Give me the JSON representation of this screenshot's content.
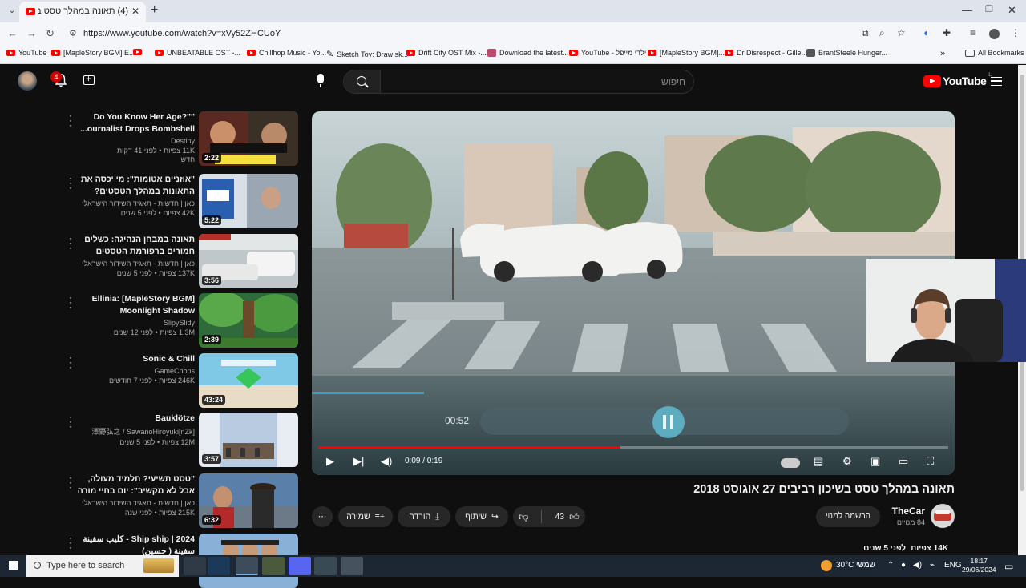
{
  "browser": {
    "tab_title": "(4) תאונה במהלך טסט בשיכון ר",
    "url": "https://www.youtube.com/watch?v=xVy52ZHCUoY",
    "bookmarks": [
      {
        "label": "YouTube",
        "icon": "youtube-icon"
      },
      {
        "label": "[MapleStory BGM] E...",
        "icon": "youtube-icon"
      },
      {
        "label": "",
        "icon": "youtube-icon"
      },
      {
        "label": "UNBEATABLE OST -...",
        "icon": "youtube-icon"
      },
      {
        "label": "Chillhop Music - Yo...",
        "icon": "youtube-icon"
      },
      {
        "label": "Sketch Toy: Draw sk...",
        "icon": "pencil-icon"
      },
      {
        "label": "Drift City OST Mix -...",
        "icon": "youtube-icon"
      },
      {
        "label": "Download the latest...",
        "icon": "image-icon"
      },
      {
        "label": "YouTube - ילדי מייפל",
        "icon": "youtube-icon"
      },
      {
        "label": "[MapleStory BGM]...",
        "icon": "youtube-icon"
      },
      {
        "label": "Dr Disrespect - Gille...",
        "icon": "youtube-icon"
      },
      {
        "label": "BrantSteele Hunger...",
        "icon": "site-icon"
      }
    ],
    "all_bookmarks": "All Bookmarks"
  },
  "header": {
    "notification_count": "4",
    "search_placeholder": "חיפוש",
    "logo_text": "YouTube",
    "logo_country": "IL"
  },
  "related": [
    {
      "title": "Do You Know Her Age?\"\" ...ournalist Drops Bombshell On",
      "channel": "Destiny",
      "meta": "11K צפיות • לפני 41 דקות",
      "badge": "חדש",
      "duration": "2:22",
      "thumb": "dr"
    },
    {
      "title": "\"אוזניים אטומות\": מי יכסה את התאונות במהלך הטסטים?",
      "channel": "כאן | חדשות - תאגיד השידור הישראלי",
      "meta": "42K צפיות • לפני 5 שנים",
      "badge": "",
      "duration": "5:22",
      "thumb": "news"
    },
    {
      "title": "תאונה במבחן הנהיגה: כשלים חמורים ברפורמת הטסטים",
      "channel": "כאן | חדשות - תאגיד השידור הישראלי",
      "meta": "137K צפיות • לפני 5 שנים",
      "badge": "",
      "duration": "3:56",
      "thumb": "car"
    },
    {
      "title": "Ellinia: [MapleStory BGM] Moonlight Shadow",
      "channel": "SlipySlidy",
      "meta": "1.3M צפיות • לפני 12 שנים",
      "badge": "",
      "duration": "2:39",
      "thumb": "forest"
    },
    {
      "title": "Sonic & Chill",
      "channel": "GameChops",
      "meta": "246K צפיות • לפני 7 חודשים",
      "badge": "",
      "duration": "43:24",
      "thumb": "sonic"
    },
    {
      "title": "Bauklötze",
      "channel": "澤野弘之 / SawanoHiroyuki[nZk]",
      "meta": "12M צפיות • לפני 5 שנים",
      "badge": "",
      "duration": "3:57",
      "thumb": "anime"
    },
    {
      "title": "\"טסט תשיעי? תלמיד מעולה, אבל לא מקשיב\": יום בחיי מורה לנהיגה על...",
      "channel": "כאן | חדשות - תאגיד השידור הישראלי",
      "meta": "215K צפיות • לפני שנה",
      "badge": "",
      "duration": "6:32",
      "thumb": "teacher"
    },
    {
      "title": "Ship ship | 2024 - كليب سفينة سفينة ( حسين) ",
      "channel": "",
      "meta": "",
      "badge": "",
      "duration": "",
      "thumb": "ship"
    }
  ],
  "player": {
    "time": "0:09 / 0:19",
    "progress_fraction": 0.48,
    "inner_time": "00:52"
  },
  "video": {
    "title": "תאונה במהלך טסט בשיכון רביבים 27 אוגוסט 2018",
    "channel_name": "TheCar",
    "subscribers": "84 מנויים",
    "subscribe_label": "הרשמה למנוי",
    "likes": "43",
    "share_label": "שיתוף",
    "download_label": "הורדה",
    "save_label": "שמירה",
    "views": "14K צפיות",
    "age": "לפני 5 שנים"
  },
  "taskbar": {
    "search_placeholder": "Type here to search",
    "weather": "30°C",
    "weather_label": "שמשי",
    "lang": "ENG",
    "time": "18:17",
    "date": "29/06/2024"
  },
  "colors": {
    "accent_red": "#ff0000",
    "background": "#0f0f0f"
  }
}
